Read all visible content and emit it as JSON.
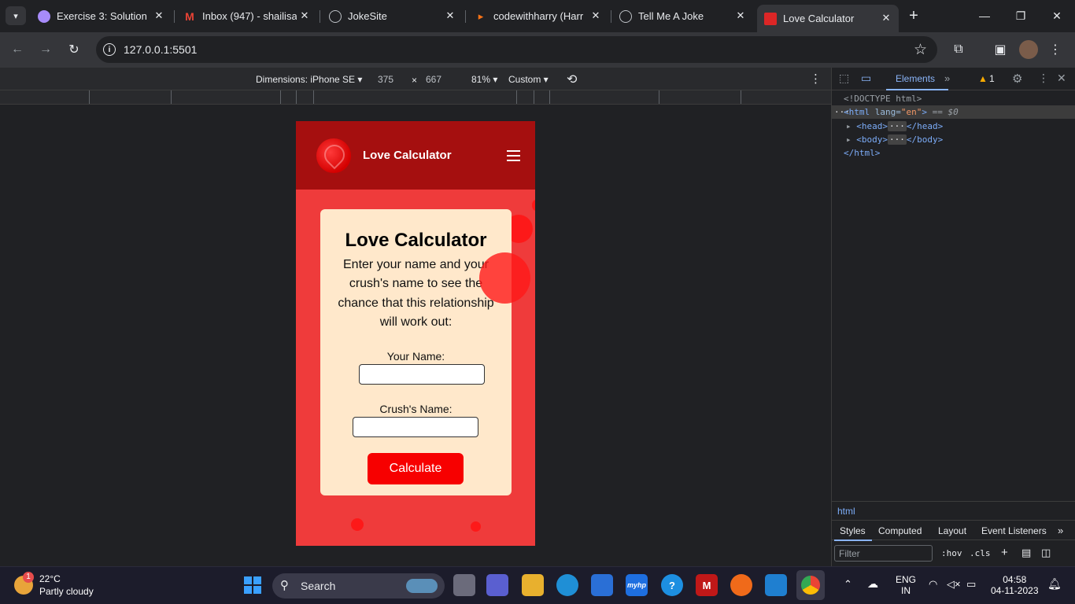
{
  "browser": {
    "tabs": [
      {
        "title": "Exercise 3: Solution &",
        "favicon": "exercise-favicon",
        "color": "#a78bfa"
      },
      {
        "title": "Inbox (947) - shailisa",
        "favicon": "gmail-favicon",
        "color": "#ea4335"
      },
      {
        "title": "JokeSite",
        "favicon": "globe-favicon",
        "color": "#bdc1c6"
      },
      {
        "title": "codewithharry (Harr",
        "favicon": "cwh-favicon",
        "color": "#f97316"
      },
      {
        "title": "Tell Me A Joke",
        "favicon": "globe-favicon",
        "color": "#bdc1c6"
      },
      {
        "title": "Love Calculator",
        "favicon": "love-favicon",
        "color": "#dc2626"
      }
    ],
    "url": "127.0.0.1:5501"
  },
  "device_toolbar": {
    "dimensions_label": "Dimensions: iPhone SE",
    "width": "375",
    "times": "×",
    "height": "667",
    "zoom": "81%",
    "throttle": "Custom"
  },
  "page": {
    "brand": "Love Calculator",
    "heading": "Love Calculator",
    "description": "Enter your name and your crush's name to see the chance that this relationship will work out:",
    "name_label": "Your Name:",
    "name_value": "",
    "crush_label": "Crush's Name:",
    "crush_value": "",
    "button_label": "Calculate",
    "colors": {
      "nav": "#a50f0f",
      "background": "#ef3b3b",
      "card": "#ffe8cb",
      "button": "#f70000"
    }
  },
  "devtools": {
    "tab_elements": "Elements",
    "warnings": "1",
    "dom": {
      "doctype": "<!DOCTYPE html>",
      "html_open": "<html",
      "lang_attr": "lang=",
      "lang_val": "\"en\"",
      "html_close_bracket": ">",
      "eq_sel": "== $0",
      "head_open": "<head>",
      "head_close": "</head>",
      "body_open": "<body>",
      "body_close": "</body>",
      "html_end": "</html>"
    },
    "breadcrumb": "html",
    "styles_tabs": [
      "Styles",
      "Computed",
      "Layout",
      "Event Listeners"
    ],
    "filter_placeholder": "Filter",
    "hov": ":hov",
    "cls": ".cls"
  },
  "taskbar": {
    "weather_temp": "22°C",
    "weather_desc": "Partly cloudy",
    "weather_badge": "1",
    "search_label": "Search",
    "lang_top": "ENG",
    "lang_bottom": "IN",
    "time": "04:58",
    "date": "04-11-2023"
  }
}
